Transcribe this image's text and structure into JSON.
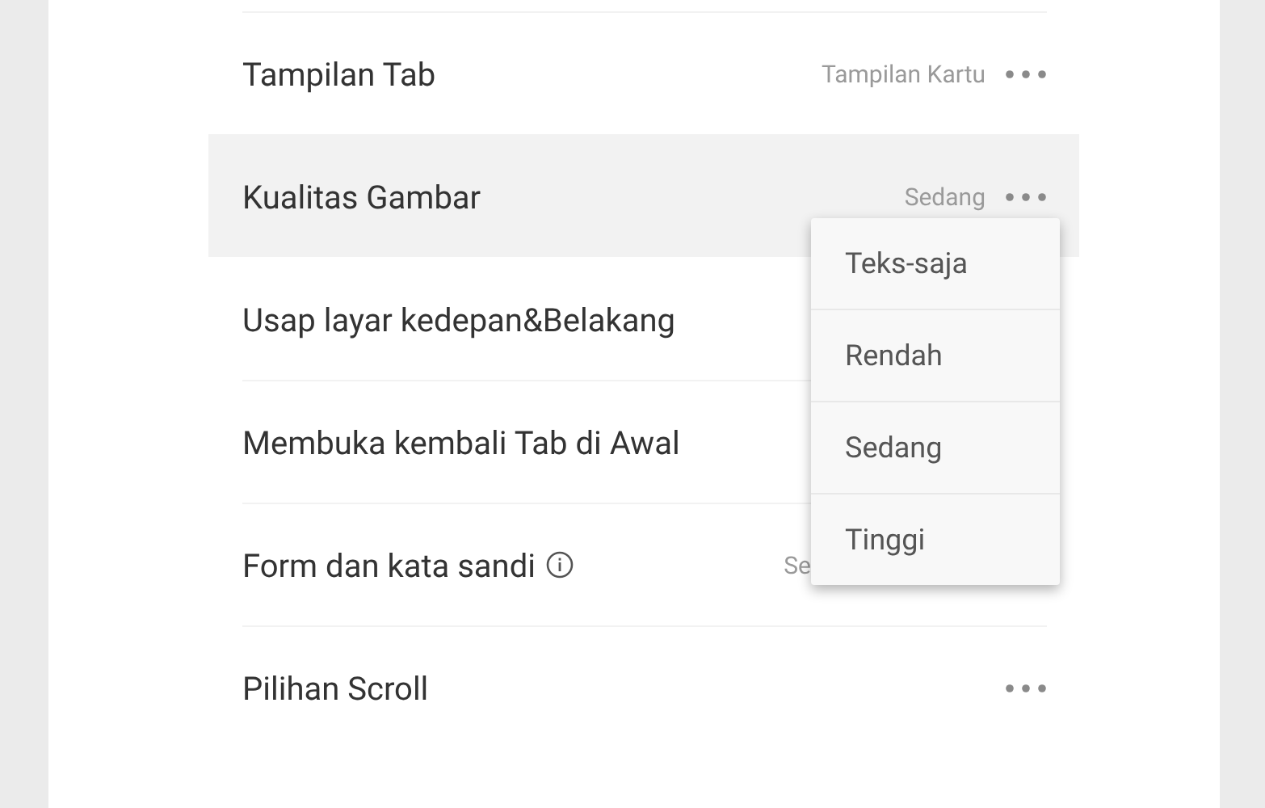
{
  "settings": [
    {
      "label": "Tampilan Tab",
      "value": "Tampilan Kartu",
      "selected": false,
      "covered": false,
      "info": false
    },
    {
      "label": "Kualitas Gambar",
      "value": "Sedang",
      "selected": true,
      "covered": false,
      "info": false
    },
    {
      "label": "Usap layar kedepan&Belakang",
      "selected": false,
      "info": false
    },
    {
      "label": "Membuka kembali Tab di Awal",
      "selected": false,
      "info": false
    },
    {
      "label": "Form dan kata sandi",
      "value": "Se",
      "selected": false,
      "covered": true,
      "info": true
    },
    {
      "label": "Pilihan Scroll",
      "selected": false,
      "covered": false,
      "info": false
    }
  ],
  "menu": {
    "items": [
      "Teks-saja",
      "Rendah",
      "Sedang",
      "Tinggi"
    ]
  }
}
